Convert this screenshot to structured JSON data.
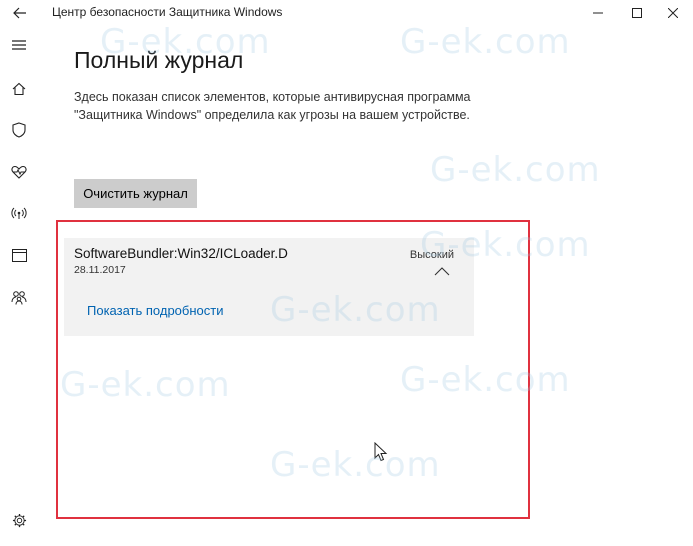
{
  "window": {
    "title": "Центр безопасности Защитника Windows"
  },
  "sidebar": {
    "items": [
      {
        "icon": "hamburger-menu-icon"
      },
      {
        "icon": "home-icon"
      },
      {
        "icon": "shield-icon"
      },
      {
        "icon": "heart-pulse-icon"
      },
      {
        "icon": "wireless-icon"
      },
      {
        "icon": "browser-window-icon"
      },
      {
        "icon": "family-icon"
      },
      {
        "icon": "gear-icon"
      }
    ]
  },
  "main": {
    "title": "Полный журнал",
    "description": "Здесь показан список элементов, которые антивирусная программа \"Защитника Windows\" определила как угрозы на вашем устройстве.",
    "clear_button": "Очистить журнал",
    "threats": [
      {
        "name": "SoftwareBundler:Win32/ICLoader.D",
        "date": "28.11.2017",
        "level": "Высокий",
        "details_link": "Показать подробности"
      }
    ]
  },
  "watermark": "G-ek.com",
  "colors": {
    "accent_link": "#0063b1",
    "highlight": "#e0313f",
    "card_bg": "#f2f2f2",
    "button_bg": "#cccccc"
  }
}
